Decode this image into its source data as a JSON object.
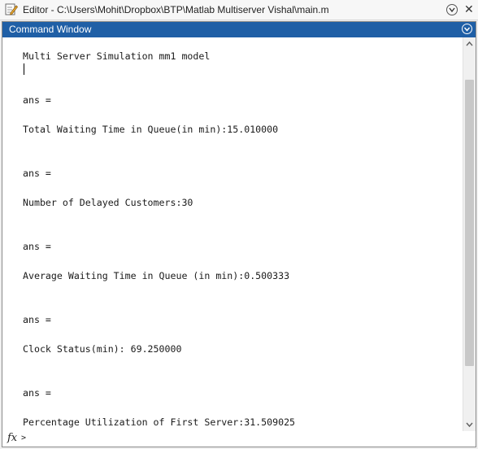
{
  "editor": {
    "title": "Editor - C:\\Users\\Mohit\\Dropbox\\BTP\\Matlab Multiserver Vishal\\main.m",
    "icon": "pencil-edit-icon"
  },
  "command_window": {
    "title": "Command Window",
    "lines": [
      "Multi Server Simulation mm1 model",
      "ans =",
      "Total Waiting Time in Queue(in min):15.010000",
      "ans =",
      "Number of Delayed Customers:30",
      "ans =",
      "Average Waiting Time in Queue (in min):0.500333",
      "ans =",
      "Clock Status(min): 69.250000",
      "ans =",
      "Percentage Utilization of First Server:31.509025"
    ],
    "prompt_icon": "fx",
    "prompt_symbol": ">"
  },
  "colors": {
    "header_bg": "#1f5fa6",
    "content_bg": "#ffffff"
  }
}
